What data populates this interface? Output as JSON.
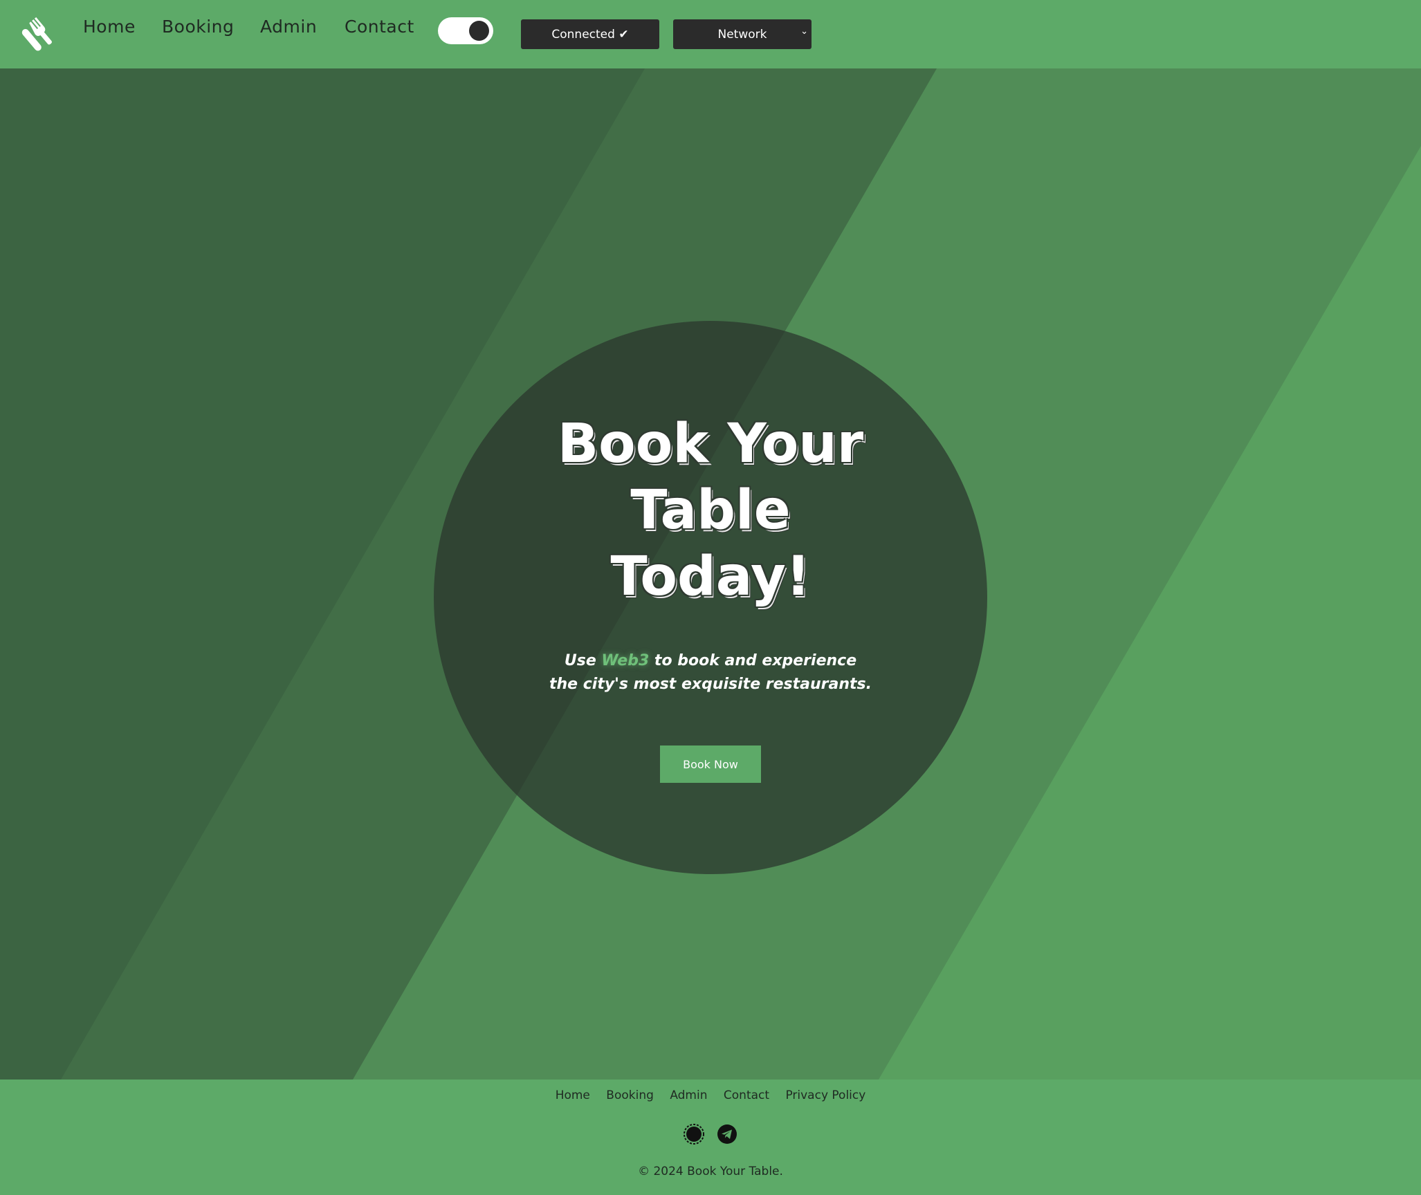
{
  "nav": {
    "logo_icon": "fork-knife-icon",
    "links": [
      "Home",
      "Booking",
      "Admin",
      "Contact"
    ],
    "theme_toggle": "dark-mode-toggle",
    "connected_label": "Connected ✔",
    "network_label": "Network"
  },
  "hero": {
    "title_lines": [
      "Book Your",
      "Table",
      "Today!"
    ],
    "subtitle_prefix": "Use ",
    "subtitle_accent": "Web3",
    "subtitle_rest": " to book and experience",
    "subtitle_line2": "the city's most exquisite restaurants.",
    "cta_label": "Book Now"
  },
  "footer": {
    "links": [
      "Home",
      "Booking",
      "Admin",
      "Contact",
      "Privacy Policy"
    ],
    "social_icons": [
      "signal-icon",
      "telegram-icon"
    ],
    "copyright": "© 2024 Book Your Table."
  },
  "colors": {
    "brand_green": "#5daa68",
    "dark": "#2b2b2b",
    "accent": "#6fc07a"
  }
}
